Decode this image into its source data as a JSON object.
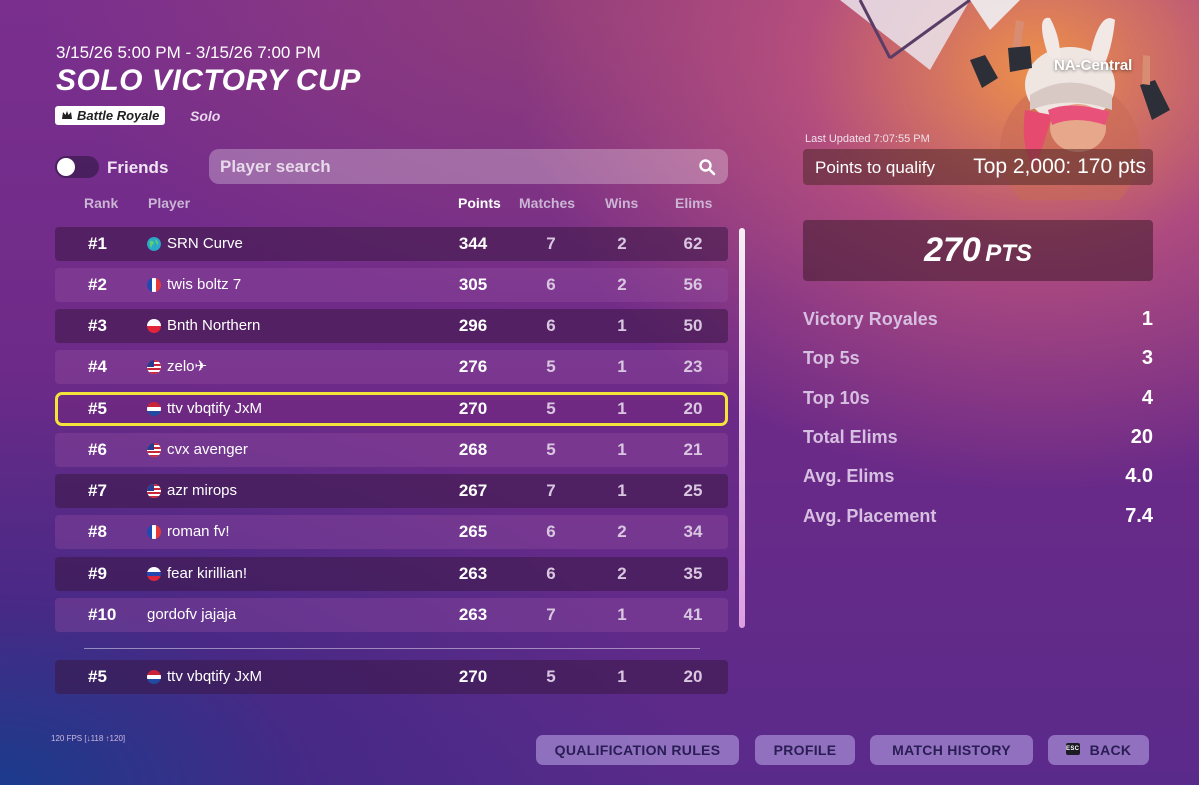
{
  "header": {
    "date_range": "3/15/26 5:00 PM - 3/15/26 7:00 PM",
    "title": "SOLO VICTORY CUP",
    "mode_badge": "Battle Royale",
    "mode_sub": "Solo"
  },
  "filters": {
    "friends_label": "Friends",
    "friends_toggle": "off",
    "search_placeholder": "Player search"
  },
  "columns": {
    "rank": "Rank",
    "player": "Player",
    "points": "Points",
    "matches": "Matches",
    "wins": "Wins",
    "elims": "Elims"
  },
  "leaderboard": [
    {
      "rank": "#1",
      "flag": "globe",
      "name": "SRN Curve",
      "points": "344",
      "matches": "7",
      "wins": "2",
      "elims": "62"
    },
    {
      "rank": "#2",
      "flag": "france",
      "name": "twis boltz 7",
      "points": "305",
      "matches": "6",
      "wins": "2",
      "elims": "56"
    },
    {
      "rank": "#3",
      "flag": "poland",
      "name": "Bnth Northern",
      "points": "296",
      "matches": "6",
      "wins": "1",
      "elims": "50"
    },
    {
      "rank": "#4",
      "flag": "usa",
      "name": "zelo✈",
      "points": "276",
      "matches": "5",
      "wins": "1",
      "elims": "23"
    },
    {
      "rank": "#5",
      "flag": "netherlands",
      "name": "ttv vbqtify JxM",
      "points": "270",
      "matches": "5",
      "wins": "1",
      "elims": "20"
    },
    {
      "rank": "#6",
      "flag": "usa",
      "name": "cvx avenger",
      "points": "268",
      "matches": "5",
      "wins": "1",
      "elims": "21"
    },
    {
      "rank": "#7",
      "flag": "usa",
      "name": "azr mirops",
      "points": "267",
      "matches": "7",
      "wins": "1",
      "elims": "25"
    },
    {
      "rank": "#8",
      "flag": "france",
      "name": "roman fv!",
      "points": "265",
      "matches": "6",
      "wins": "2",
      "elims": "34"
    },
    {
      "rank": "#9",
      "flag": "russia",
      "name": "fear kirillian!",
      "points": "263",
      "matches": "6",
      "wins": "2",
      "elims": "35"
    },
    {
      "rank": "#10",
      "flag": "",
      "name": "gordofv jajaja",
      "points": "263",
      "matches": "7",
      "wins": "1",
      "elims": "41"
    }
  ],
  "current_player": {
    "rank": "#5",
    "flag": "netherlands",
    "name": "ttv vbqtify JxM",
    "points": "270",
    "matches": "5",
    "wins": "1",
    "elims": "20"
  },
  "side_panel": {
    "region": "NA-Central",
    "last_updated": "Last Updated 7:07:55 PM",
    "qualify_label": "Points to qualify",
    "qualify_value": "Top 2,000: 170 pts",
    "points_value": "270",
    "points_unit": "PTS",
    "stats": [
      {
        "label": "Victory Royales",
        "value": "1"
      },
      {
        "label": "Top 5s",
        "value": "3"
      },
      {
        "label": "Top 10s",
        "value": "4"
      },
      {
        "label": "Total Elims",
        "value": "20"
      },
      {
        "label": "Avg. Elims",
        "value": "4.0"
      },
      {
        "label": "Avg. Placement",
        "value": "7.4"
      }
    ]
  },
  "footer": {
    "fps": "120 FPS [↓118 ↑120]",
    "buttons": {
      "qualification_rules": "QUALIFICATION RULES",
      "profile": "PROFILE",
      "match_history": "MATCH HISTORY",
      "back": "BACK",
      "esc_key": "ESC"
    }
  },
  "colors": {
    "highlight_border": "#f2e43a",
    "button_bg": "#b9a6e6",
    "button_text": "#2a1d55"
  }
}
